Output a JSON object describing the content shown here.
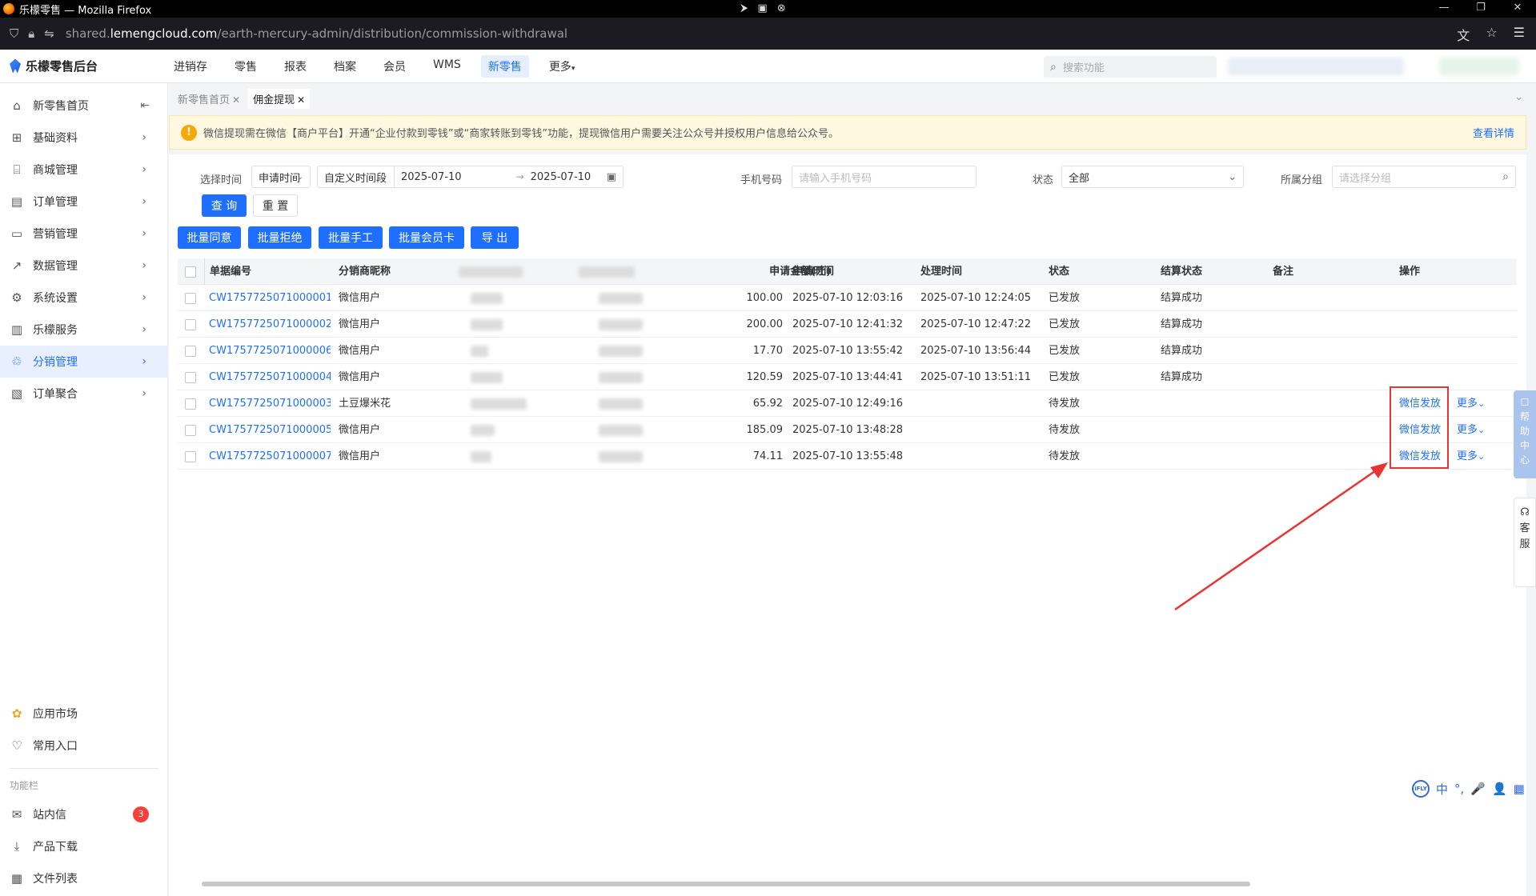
{
  "browser": {
    "window_title": "乐檬零售 — Mozilla Firefox",
    "url_prefix": "shared.",
    "url_domain": "lemengcloud.com",
    "url_path": "/earth-mercury-admin/distribution/commission-withdrawal"
  },
  "app": {
    "brand": "乐檬零售后台",
    "top_menu": [
      "进销存",
      "零售",
      "报表",
      "档案",
      "会员",
      "WMS",
      "新零售",
      "更多"
    ],
    "active_menu": "新零售",
    "search_placeholder": "搜索功能"
  },
  "sidebar": {
    "items": [
      {
        "label": "新零售首页",
        "icon": "home-icon"
      },
      {
        "label": "基础资料",
        "icon": "grid-icon"
      },
      {
        "label": "商城管理",
        "icon": "store-icon"
      },
      {
        "label": "订单管理",
        "icon": "document-icon"
      },
      {
        "label": "营销管理",
        "icon": "chart-board-icon"
      },
      {
        "label": "数据管理",
        "icon": "line-chart-icon"
      },
      {
        "label": "系统设置",
        "icon": "settings-icon"
      },
      {
        "label": "乐檬服务",
        "icon": "briefcase-icon"
      },
      {
        "label": "分销管理",
        "icon": "distribution-icon"
      },
      {
        "label": "订单聚合",
        "icon": "order-aggregate-icon"
      }
    ],
    "active": "分销管理",
    "bottom_items": [
      {
        "label": "应用市场",
        "icon": "app-market-icon"
      },
      {
        "label": "常用入口",
        "icon": "heart-icon"
      }
    ],
    "section_label": "功能栏",
    "func_items": [
      {
        "label": "站内信",
        "icon": "mail-icon",
        "badge": "3"
      },
      {
        "label": "产品下载",
        "icon": "download-icon"
      },
      {
        "label": "文件列表",
        "icon": "file-list-icon"
      }
    ]
  },
  "tabs": [
    {
      "label": "新零售首页"
    },
    {
      "label": "佣金提现"
    }
  ],
  "alert": {
    "text": "微信提现需在微信【商户平台】开通“企业付款到零钱”或“商家转账到零钱”功能，提现微信用户需要关注公众号并授权用户信息给公众号。",
    "link": "查看详情"
  },
  "filters": {
    "time_label": "选择时间",
    "time_type": "申请时间",
    "range_type": "自定义时间段",
    "date_start": "2025-07-10",
    "date_sep": "→",
    "date_end": "2025-07-10",
    "phone_label": "手机号码",
    "phone_placeholder": "请输入手机号码",
    "status_label": "状态",
    "status_value": "全部",
    "group_label": "所属分组",
    "group_placeholder": "请选择分组",
    "query": "查 询",
    "reset": "重 置"
  },
  "batch_buttons": [
    "批量同意",
    "批量拒绝",
    "批量手工",
    "批量会员卡",
    "导 出"
  ],
  "table": {
    "headers": [
      "单据编号",
      "分销商昵称",
      "申请金额(元)",
      "申请时间",
      "处理时间",
      "状态",
      "结算状态",
      "备注",
      "操作"
    ],
    "rows": [
      {
        "id": "CW1757725071000001",
        "nick": "微信用户",
        "amount": "100.00",
        "apply": "2025-07-10 12:03:16",
        "process": "2025-07-10 12:24:05",
        "status": "已发放",
        "settle": "结算成功",
        "action": "",
        "more": ""
      },
      {
        "id": "CW1757725071000002",
        "nick": "微信用户",
        "amount": "200.00",
        "apply": "2025-07-10 12:41:32",
        "process": "2025-07-10 12:47:22",
        "status": "已发放",
        "settle": "结算成功",
        "action": "",
        "more": ""
      },
      {
        "id": "CW1757725071000006",
        "nick": "微信用户",
        "amount": "17.70",
        "apply": "2025-07-10 13:55:42",
        "process": "2025-07-10 13:56:44",
        "status": "已发放",
        "settle": "结算成功",
        "action": "",
        "more": ""
      },
      {
        "id": "CW1757725071000004",
        "nick": "微信用户",
        "amount": "120.59",
        "apply": "2025-07-10 13:44:41",
        "process": "2025-07-10 13:51:11",
        "status": "已发放",
        "settle": "结算成功",
        "action": "",
        "more": ""
      },
      {
        "id": "CW1757725071000003",
        "nick": "土豆爆米花",
        "amount": "65.92",
        "apply": "2025-07-10 12:49:16",
        "process": "",
        "status": "待发放",
        "settle": "",
        "action": "微信发放",
        "more": "更多"
      },
      {
        "id": "CW1757725071000005",
        "nick": "微信用户",
        "amount": "185.09",
        "apply": "2025-07-10 13:48:28",
        "process": "",
        "status": "待发放",
        "settle": "",
        "action": "微信发放",
        "more": "更多"
      },
      {
        "id": "CW1757725071000007",
        "nick": "微信用户",
        "amount": "74.11",
        "apply": "2025-07-10 13:55:48",
        "process": "",
        "status": "待发放",
        "settle": "",
        "action": "微信发放",
        "more": "更多"
      }
    ]
  },
  "floating": {
    "help_text": "帮助中心",
    "service_text": "客服",
    "ime": [
      "中",
      "°,",
      "🎤",
      "👤",
      "▦"
    ]
  },
  "colors": {
    "primary": "#1e6fff",
    "annotation_red": "#e93434",
    "alert_bg": "#fff8e1"
  }
}
